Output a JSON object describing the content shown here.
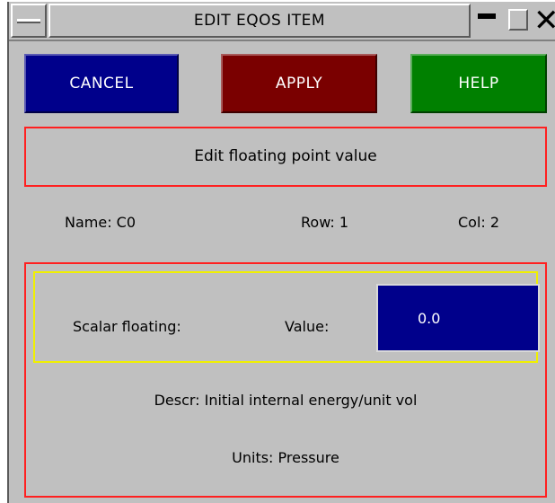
{
  "window": {
    "title": "EDIT EQOS ITEM"
  },
  "toolbar": {
    "cancel_label": "CANCEL",
    "apply_label": "APPLY",
    "help_label": "HELP"
  },
  "info": {
    "heading": "Edit floating point value",
    "name": "Name: C0",
    "row": "Row: 1",
    "col": "Col: 2"
  },
  "scalar": {
    "label": "Scalar floating:",
    "value_label": "Value:",
    "value": "0.0"
  },
  "details": {
    "descr": "Descr: Initial internal energy/unit vol",
    "units": "Units: Pressure"
  },
  "colors": {
    "cancel": "#00008b",
    "apply": "#7a0000",
    "help": "#008000",
    "panel_border": "#ff2020",
    "scalar_border": "#f0f000",
    "background": "#c0c0c0"
  }
}
